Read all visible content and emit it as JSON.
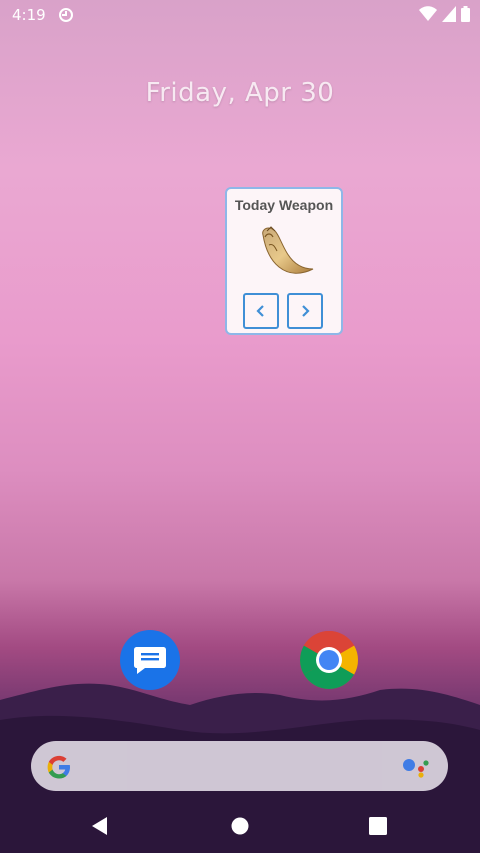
{
  "status_bar": {
    "time": "4:19",
    "left_icon": "do-not-disturb-icon",
    "right_icons": [
      "wifi-icon",
      "cell-signal-icon",
      "battery-icon"
    ]
  },
  "home": {
    "date": "Friday, Apr 30"
  },
  "widget": {
    "title": "Today Weapon",
    "image": "horn-weapon-image",
    "prev_icon": "chevron-left-icon",
    "next_icon": "chevron-right-icon"
  },
  "dock": {
    "apps": [
      {
        "name": "Messages",
        "icon": "messages-icon"
      },
      {
        "name": "Chrome",
        "icon": "chrome-icon"
      }
    ]
  },
  "search": {
    "logo": "google-g-icon",
    "assistant": "assistant-icon"
  },
  "navigation": {
    "buttons": [
      "back-icon",
      "home-icon",
      "recents-icon"
    ]
  },
  "colors": {
    "widget_border": "#8eb7e8",
    "widget_button": "#3f8fd6",
    "messages_blue": "#1a73e8"
  }
}
